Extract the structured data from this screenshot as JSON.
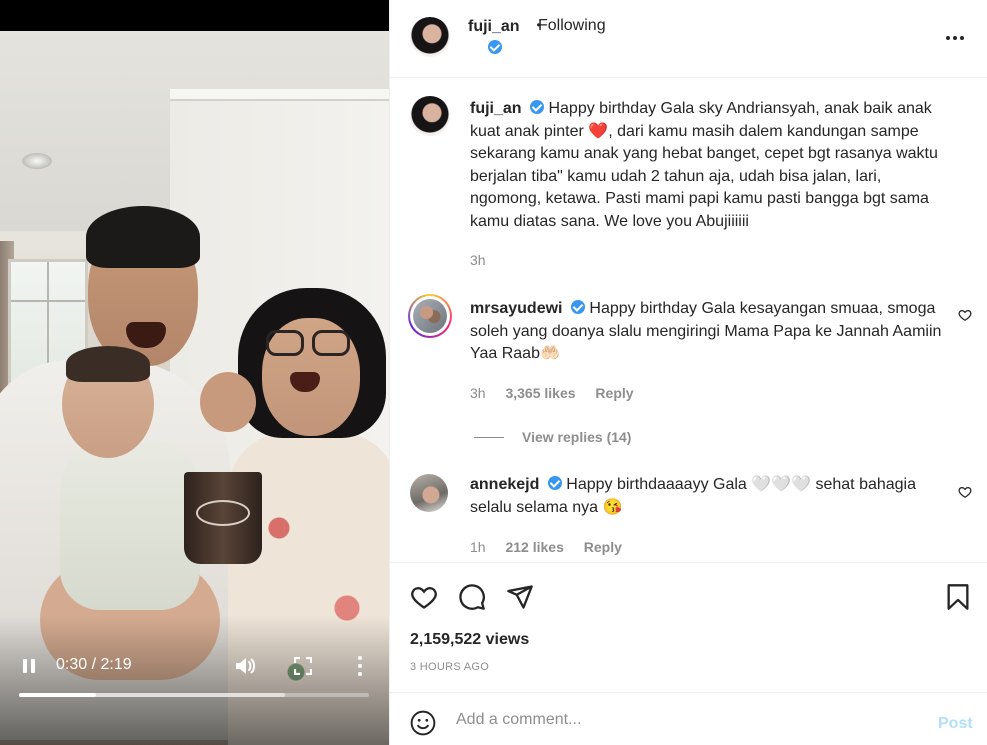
{
  "video": {
    "time_current": "0:30",
    "time_total": "2:19",
    "progress": 0.22,
    "buffered": 0.76
  },
  "header": {
    "username": "fuji_an",
    "separator": "•",
    "follow_status": "Following",
    "more_icon": "more-horizontal-icon"
  },
  "caption": {
    "username": "fuji_an",
    "text_before_heart": "Happy birthday Gala sky Andriansyah, anak baik anak kuat anak pinter",
    "heart": "❤️",
    "text_after_heart": ", dari kamu masih dalem kandungan sampe sekarang kamu anak yang hebat banget, cepet bgt rasanya waktu berjalan tiba\" kamu udah 2 tahun aja, udah bisa jalan, lari, ngomong, ketawa. Pasti mami papi kamu pasti bangga bgt sama kamu diatas sana. We love you Abujiiiiii",
    "time": "3h"
  },
  "comments": [
    {
      "username": "mrsayudewi",
      "text": "Happy birthday Gala kesayangan smuaa, smoga soleh yang doanya slalu mengiringi Mama Papa ke Jannah Aamiin Yaa Raab🤲🏻",
      "time": "3h",
      "likes": "3,365 likes",
      "reply": "Reply",
      "view_replies": "View replies (14)"
    },
    {
      "username": "annekejd",
      "text": "Happy birthdaaaayy Gala 🤍🤍🤍 sehat bahagia selalu selama nya 😘",
      "time": "1h",
      "likes": "212 likes",
      "reply": "Reply"
    }
  ],
  "stats": {
    "views": "2,159,522 views",
    "posted": "3 HOURS AGO"
  },
  "composer": {
    "placeholder": "Add a comment...",
    "post_label": "Post"
  },
  "colors": {
    "verified": "#3897f0",
    "muted": "#8e8e8e",
    "post_disabled": "#b2dffc",
    "heart": "#ed4956"
  }
}
